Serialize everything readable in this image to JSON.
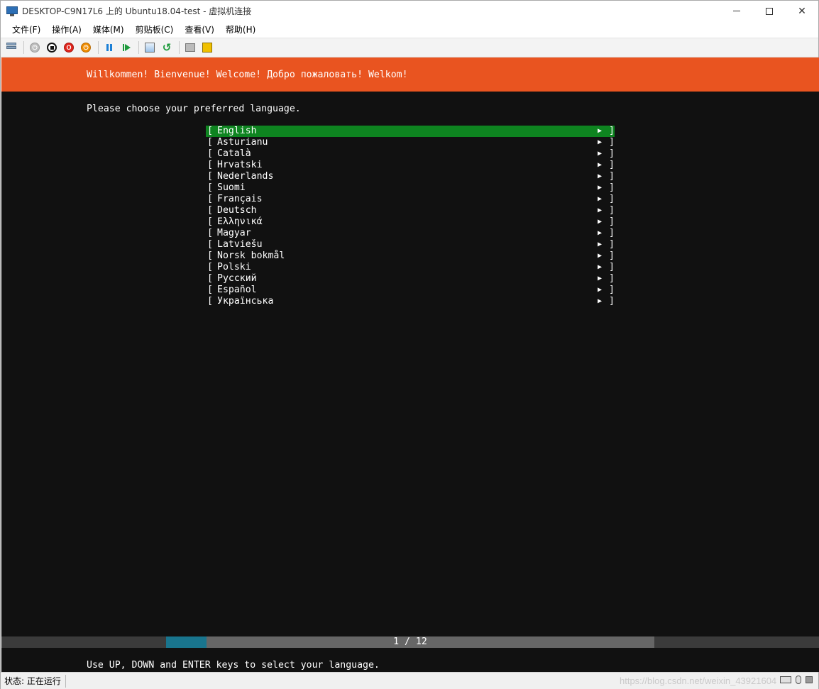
{
  "window": {
    "title": "DESKTOP-C9N17L6 上的 Ubuntu18.04-test - 虚拟机连接"
  },
  "menu": [
    {
      "label": "文件(F)",
      "name": "menu-file"
    },
    {
      "label": "操作(A)",
      "name": "menu-action"
    },
    {
      "label": "媒体(M)",
      "name": "menu-media"
    },
    {
      "label": "剪贴板(C)",
      "name": "menu-clipboard"
    },
    {
      "label": "查看(V)",
      "name": "menu-view"
    },
    {
      "label": "帮助(H)",
      "name": "menu-help"
    }
  ],
  "toolbar": {
    "icons": [
      "ctrl-alt-del-icon",
      "start-icon",
      "turn-off-icon",
      "shut-down-icon",
      "save-icon",
      "pause-icon",
      "resume-icon",
      "checkpoint-icon",
      "revert-icon",
      "basic-session-icon",
      "enhanced-session-icon"
    ]
  },
  "installer": {
    "banner": "Willkommen! Bienvenue! Welcome! Добро пожаловать! Welkom!",
    "prompt": "Please choose your preferred language.",
    "languages": [
      "English",
      "Asturianu",
      "Català",
      "Hrvatski",
      "Nederlands",
      "Suomi",
      "Français",
      "Deutsch",
      "Ελληνικά",
      "Magyar",
      "Latviešu",
      "Norsk bokmål",
      "Polski",
      "Русский",
      "Español",
      "Українська"
    ],
    "selected_index": 0,
    "bracket_left": "[",
    "bracket_right": "]",
    "arrow": "▶",
    "progress": {
      "label": "1 / 12",
      "current": 1,
      "total": 12
    },
    "help": "Use UP, DOWN and ENTER keys to select your language."
  },
  "colors": {
    "banner": "#e95420",
    "selected_row": "#0e8420",
    "progress_fill": "#19758e",
    "console_bg": "#111111"
  },
  "statusbar": {
    "status": "状态: 正在运行",
    "watermark": "https://blog.csdn.net/weixin_43921604"
  }
}
